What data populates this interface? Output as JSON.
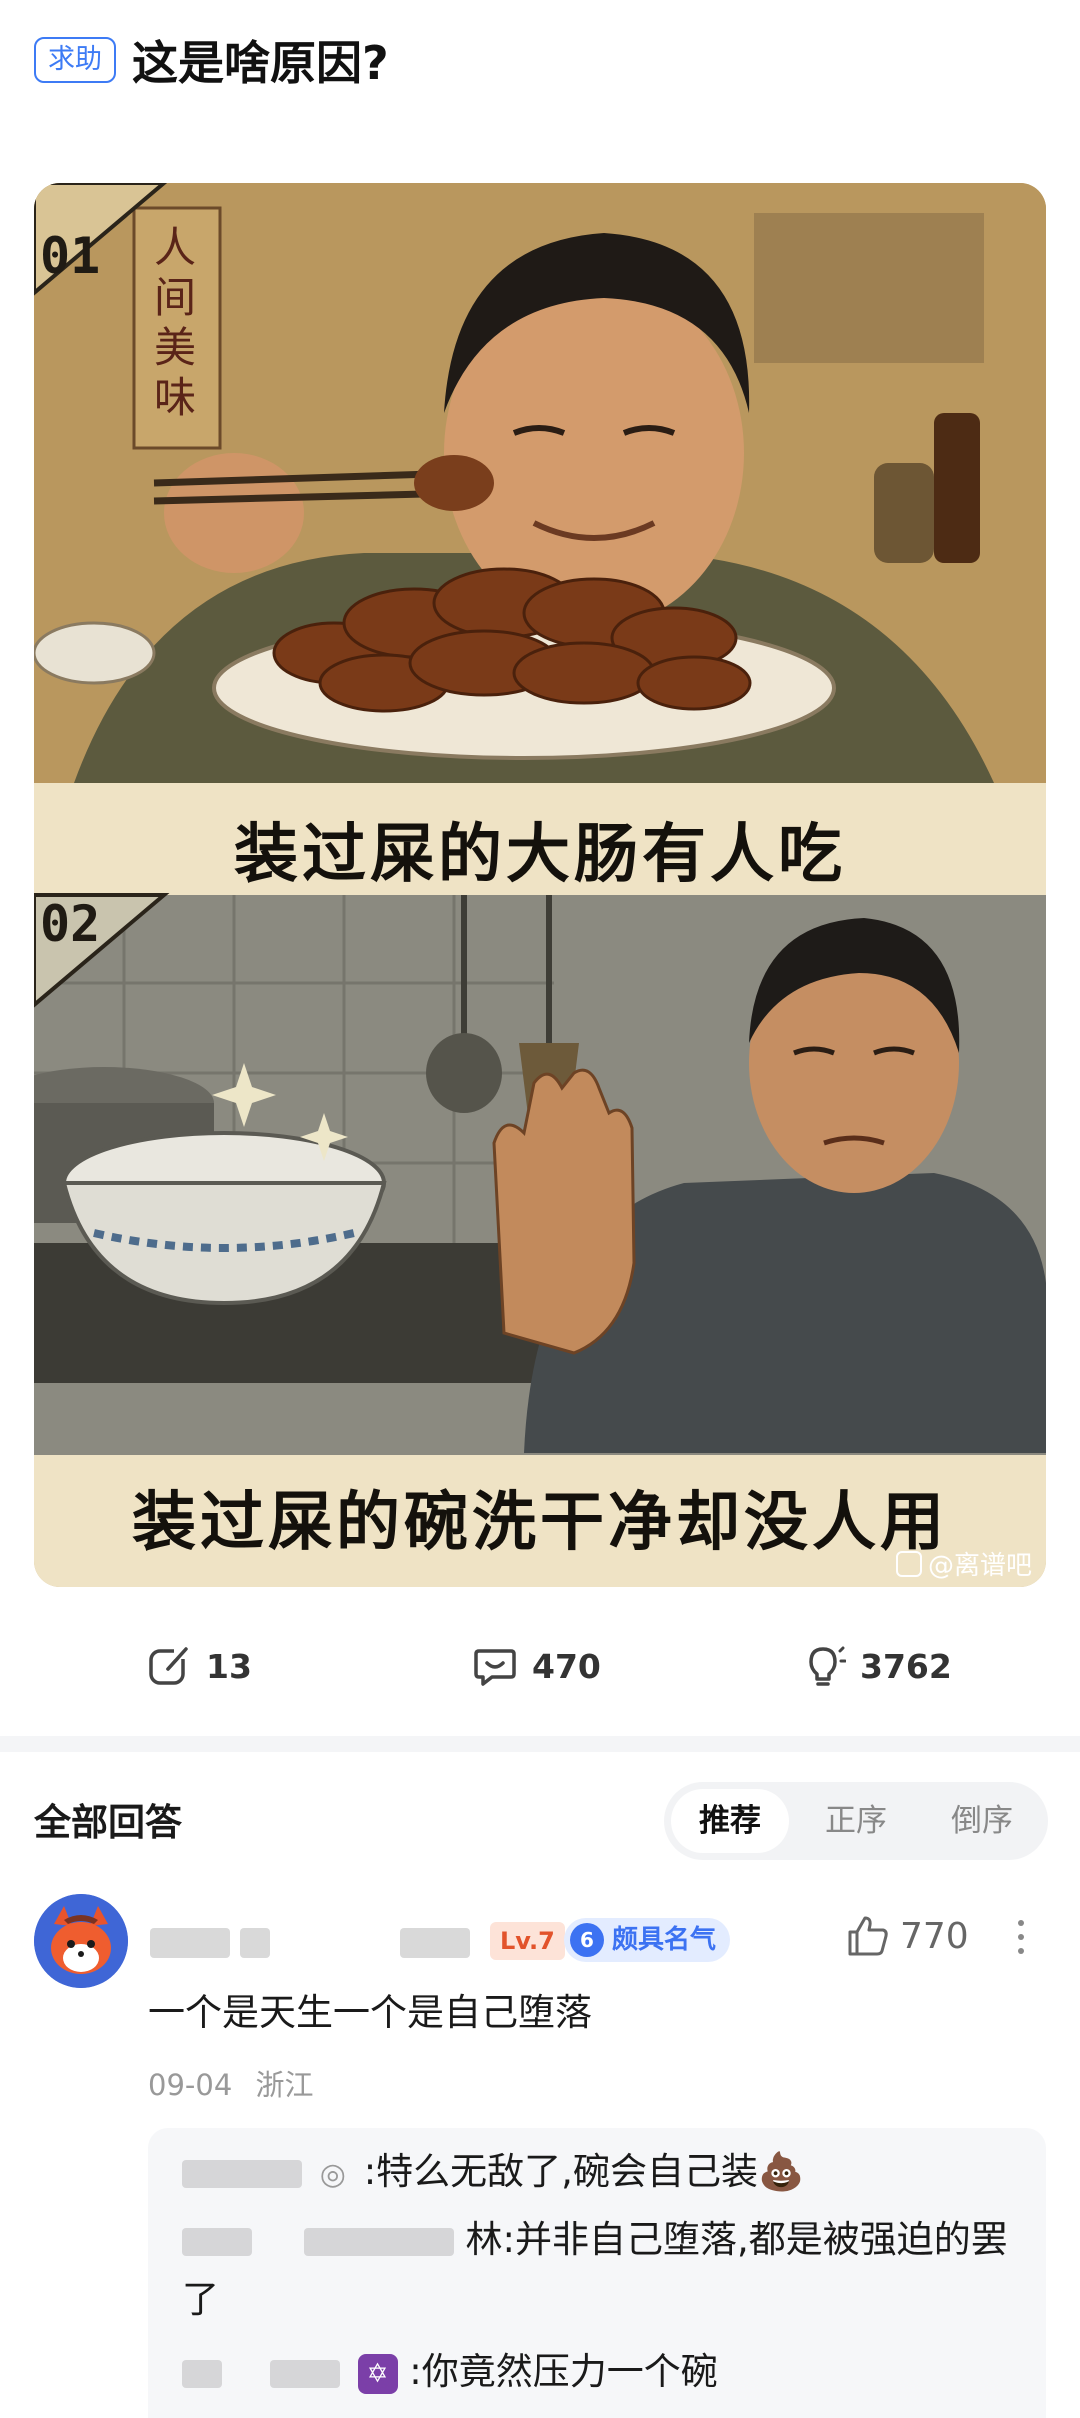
{
  "post": {
    "tag": "求助",
    "title": "这是啥原因?"
  },
  "illustration": {
    "panel1_number": "01",
    "panel1_sign": "人间美味",
    "panel1_caption": "装过屎的大肠有人吃",
    "panel2_number": "02",
    "panel2_caption": "装过屎的碗洗干净却没人用",
    "watermark": "@离谱吧"
  },
  "stats": {
    "shares": "13",
    "comments": "470",
    "likes": "3762"
  },
  "answers": {
    "title": "全部回答",
    "sort_options": [
      "推荐",
      "正序",
      "倒序"
    ]
  },
  "comment": {
    "level": "Lv.7",
    "fame_level": "6",
    "fame_label": "颇具名气",
    "likes": "770",
    "text": "一个是天生一个是自己堕落",
    "date": "09-04",
    "location": "浙江",
    "replies": [
      {
        "text": ":特么无敌了,碗会自己装💩"
      },
      {
        "suffix": "林",
        "text": ":并非自己堕落,都是被强迫的罢了"
      },
      {
        "text": ":你竟然压力一个碗"
      }
    ]
  },
  "colors": {
    "accent": "#3d7bf5",
    "level_badge": "#e2532b",
    "fame_badge": "#3c72f2"
  }
}
